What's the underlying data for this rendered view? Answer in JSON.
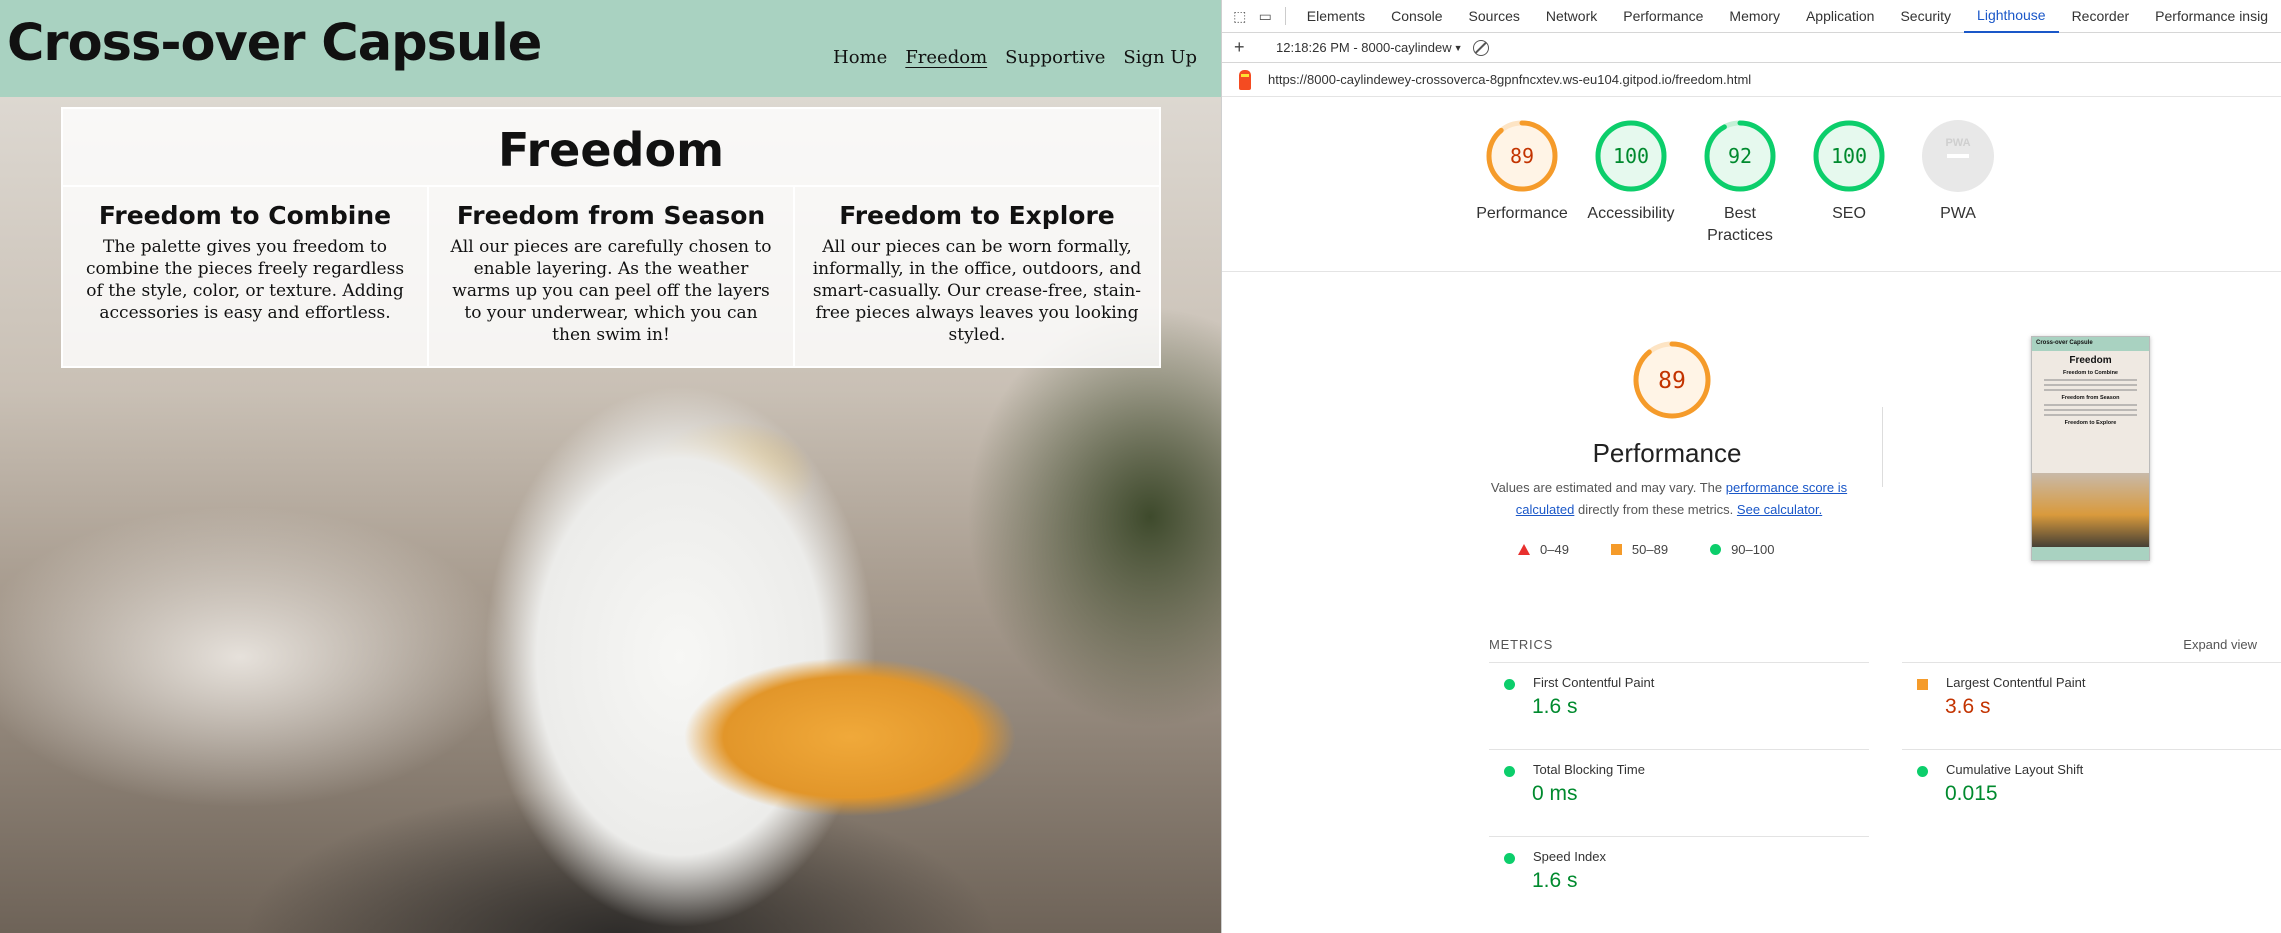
{
  "site": {
    "brand": "Cross-over Capsule",
    "nav": [
      "Home",
      "Freedom",
      "Supportive",
      "Sign Up"
    ],
    "panel_title": "Freedom",
    "columns": [
      {
        "title": "Freedom to Combine",
        "text": "The palette gives you freedom to combine the pieces freely regardless of the style, color, or texture. Adding accessories is easy and effortless."
      },
      {
        "title": "Freedom from Season",
        "text": "All our pieces are carefully chosen to enable layering. As the weather warms up you can peel off the layers to your underwear, which you can then swim in!"
      },
      {
        "title": "Freedom to Explore",
        "text": "All our pieces can be worn formally, informally, in the office, outdoors, and smart-casually. Our crease-free, stain-free pieces always leaves you looking styled."
      }
    ]
  },
  "devtools": {
    "tabs": [
      "Elements",
      "Console",
      "Sources",
      "Network",
      "Performance",
      "Memory",
      "Application",
      "Security",
      "Lighthouse",
      "Recorder",
      "Performance insig"
    ],
    "report_select": "12:18:26 PM - 8000-caylindew",
    "url": "https://8000-caylindewey-crossoverca-8gpnfncxtev.ws-eu104.gitpod.io/freedom.html",
    "gauges": [
      {
        "label": "Performance",
        "score": "89",
        "color": "#f59b2a"
      },
      {
        "label": "Accessibility",
        "score": "100",
        "color": "#0cce6b"
      },
      {
        "label": "Best Practices",
        "label_line1": "Best",
        "label_line2": "Practices",
        "score": "92",
        "color": "#0cce6b"
      },
      {
        "label": "SEO",
        "score": "100",
        "color": "#0cce6b"
      },
      {
        "label": "PWA",
        "score": "PWA",
        "color": "#cccccc"
      }
    ],
    "perf_score": "89",
    "perf_title": "Performance",
    "perf_desc_1": "Values are estimated and may vary. The",
    "perf_link_1": "performance score is calculated",
    "perf_desc_2": "directly from these metrics.",
    "perf_link_2": "See calculator.",
    "legend": [
      "0–49",
      "50–89",
      "90–100"
    ],
    "thumb": {
      "brand": "Cross-over Capsule",
      "title": "Freedom",
      "s1": "Freedom to Combine",
      "s2": "Freedom from Season",
      "s3": "Freedom to Explore"
    },
    "metrics_heading": "METRICS",
    "expand_label": "Expand view",
    "metrics": [
      {
        "label": "First Contentful Paint",
        "value": "1.6 s",
        "status": "good"
      },
      {
        "label": "Largest Contentful Paint",
        "value": "3.6 s",
        "status": "average"
      },
      {
        "label": "Total Blocking Time",
        "value": "0 ms",
        "status": "good"
      },
      {
        "label": "Cumulative Layout Shift",
        "value": "0.015",
        "status": "good"
      },
      {
        "label": "Speed Index",
        "value": "1.6 s",
        "status": "good"
      }
    ]
  }
}
